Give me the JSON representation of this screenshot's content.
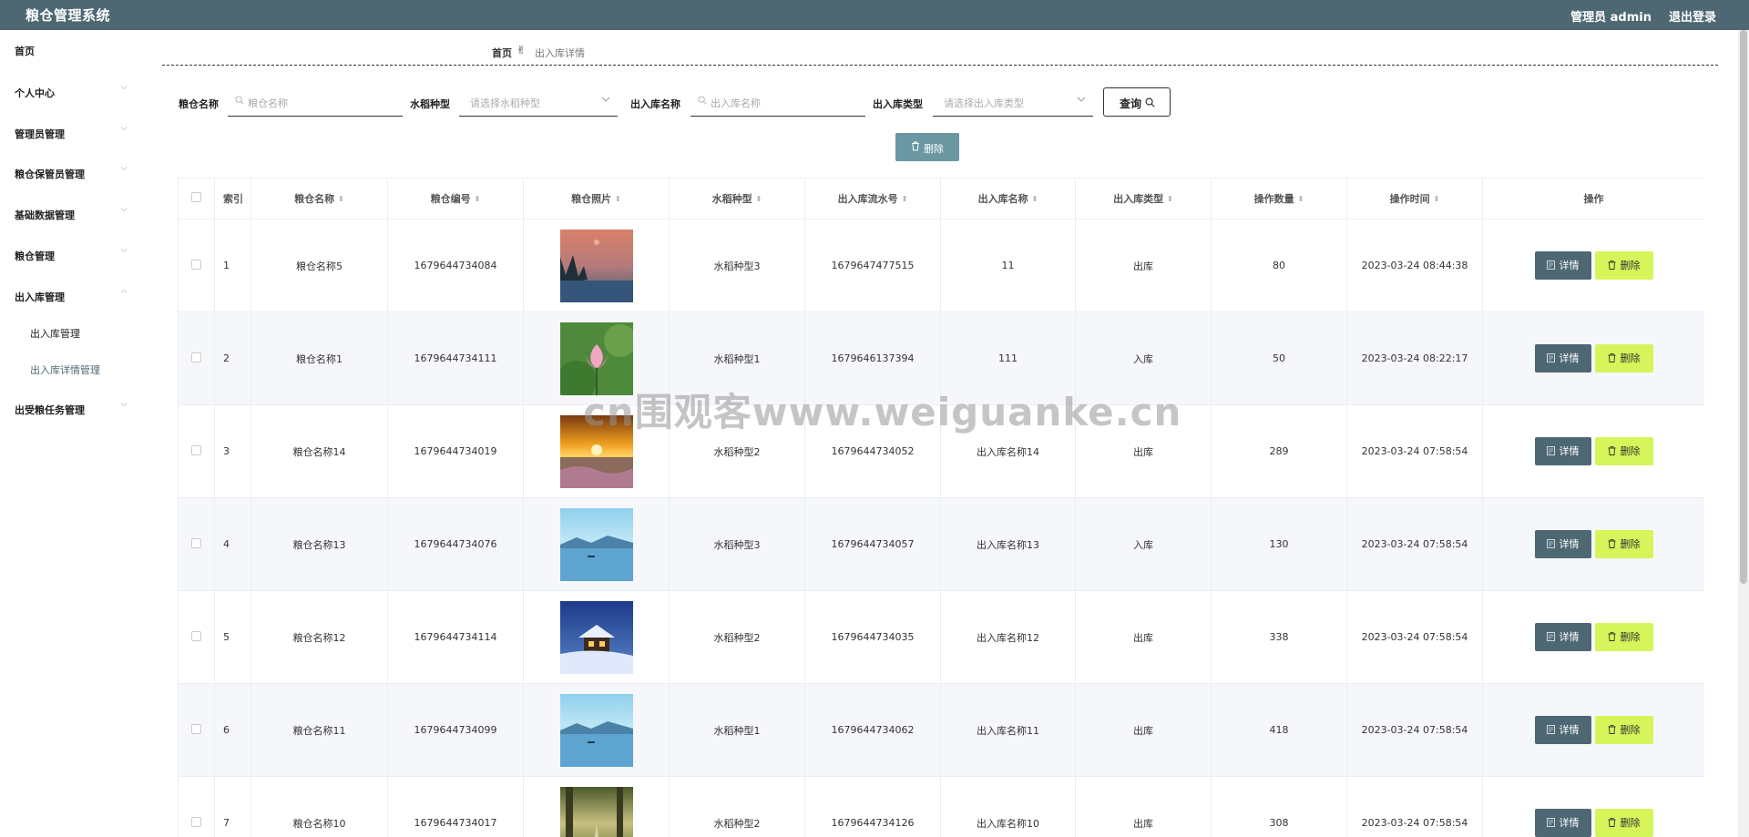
{
  "header": {
    "title": "粮仓管理系统",
    "user": "管理员 admin",
    "logout": "退出登录"
  },
  "sidebar": {
    "items": [
      {
        "label": "首页"
      },
      {
        "label": "个人中心"
      },
      {
        "label": "管理员管理"
      },
      {
        "label": "粮仓保管员管理"
      },
      {
        "label": "基础数据管理"
      },
      {
        "label": "粮仓管理"
      },
      {
        "label": "出入库管理"
      },
      {
        "label": "出受粮任务管理"
      }
    ],
    "subitems": [
      {
        "label": "出入库管理"
      },
      {
        "label": "出入库详情管理"
      }
    ]
  },
  "breadcrumb": {
    "home": "首页",
    "current": "出入库详情"
  },
  "search": {
    "granary_label": "粮仓名称",
    "granary_placeholder": "粮仓名称",
    "rice_label": "水稻种型",
    "rice_placeholder": "请选择水稻种型",
    "inout_name_label": "出入库名称",
    "inout_name_placeholder": "出入库名称",
    "inout_type_label": "出入库类型",
    "inout_type_placeholder": "请选择出入库类型",
    "query": "查询"
  },
  "toolbar": {
    "delete": "删除"
  },
  "table": {
    "headers": [
      "索引",
      "粮仓名称",
      "粮仓编号",
      "粮仓照片",
      "水稻种型",
      "出入库流水号",
      "出入库名称",
      "出入库类型",
      "操作数量",
      "操作时间",
      "操作"
    ],
    "detail_label": "详情",
    "delete_label": "删除",
    "rows": [
      {
        "index": "1",
        "name": "粮仓名称5",
        "code": "1679644734084",
        "photo": "sunset-lake",
        "rice": "水稻种型3",
        "serial": "1679647477515",
        "inout_name": "11",
        "type": "出库",
        "qty": "80",
        "time": "2023-03-24 08:44:38"
      },
      {
        "index": "2",
        "name": "粮仓名称1",
        "code": "1679644734111",
        "photo": "lotus",
        "rice": "水稻种型1",
        "serial": "1679646137394",
        "inout_name": "111",
        "type": "入库",
        "qty": "50",
        "time": "2023-03-24 08:22:17"
      },
      {
        "index": "3",
        "name": "粮仓名称14",
        "code": "1679644734019",
        "photo": "sunrise-field",
        "rice": "水稻种型2",
        "serial": "1679644734052",
        "inout_name": "出入库名称14",
        "type": "出库",
        "qty": "289",
        "time": "2023-03-24 07:58:54"
      },
      {
        "index": "4",
        "name": "粮仓名称13",
        "code": "1679644734076",
        "photo": "blue-lake",
        "rice": "水稻种型3",
        "serial": "1679644734057",
        "inout_name": "出入库名称13",
        "type": "入库",
        "qty": "130",
        "time": "2023-03-24 07:58:54"
      },
      {
        "index": "5",
        "name": "粮仓名称12",
        "code": "1679644734114",
        "photo": "snow-cabin",
        "rice": "水稻种型2",
        "serial": "1679644734035",
        "inout_name": "出入库名称12",
        "type": "出库",
        "qty": "338",
        "time": "2023-03-24 07:58:54"
      },
      {
        "index": "6",
        "name": "粮仓名称11",
        "code": "1679644734099",
        "photo": "blue-lake",
        "rice": "水稻种型1",
        "serial": "1679644734062",
        "inout_name": "出入库名称11",
        "type": "出库",
        "qty": "418",
        "time": "2023-03-24 07:58:54"
      },
      {
        "index": "7",
        "name": "粮仓名称10",
        "code": "1679644734017",
        "photo": "forest-path",
        "rice": "水稻种型2",
        "serial": "1679644734126",
        "inout_name": "出入库名称10",
        "type": "出库",
        "qty": "308",
        "time": "2023-03-24 07:58:54"
      }
    ]
  },
  "watermark": "cn围观客www.weiguanke.cn",
  "colors": {
    "header": "#4d6873",
    "detail_button": "#4d6873",
    "delete_button": "#d6f55a",
    "bulk_delete": "#6a97a2"
  }
}
